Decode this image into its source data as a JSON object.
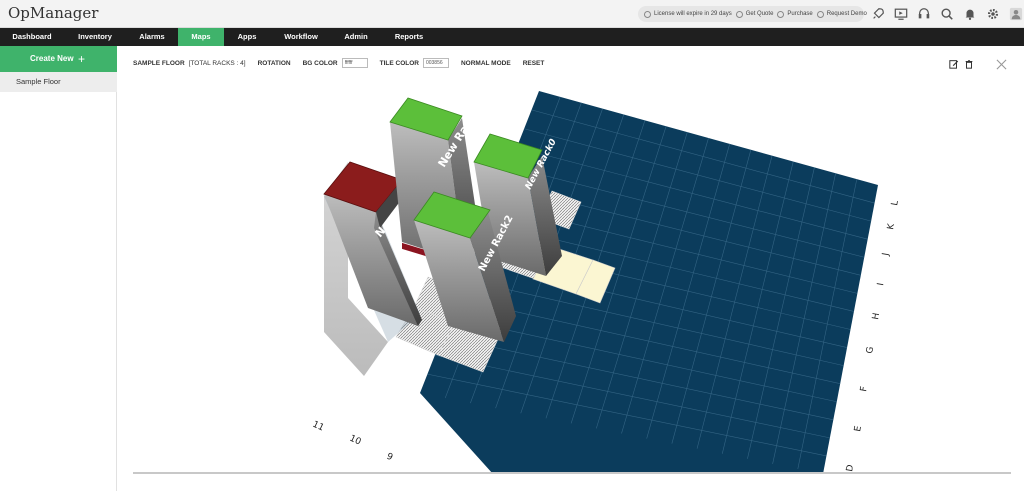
{
  "app": {
    "title": "OpManager"
  },
  "license_bar": {
    "items": [
      "License will expire in 29 days",
      "Get Quote",
      "Purchase",
      "Request Demo"
    ]
  },
  "header_icons": [
    "rocket-icon",
    "screen-icon",
    "headset-icon",
    "search-icon",
    "bell-icon",
    "gear-icon",
    "user-icon"
  ],
  "nav": {
    "items": [
      {
        "label": "Dashboard",
        "active": false
      },
      {
        "label": "Inventory",
        "active": false
      },
      {
        "label": "Alarms",
        "active": false
      },
      {
        "label": "Maps",
        "active": true
      },
      {
        "label": "Apps",
        "active": false
      },
      {
        "label": "Workflow",
        "active": false
      },
      {
        "label": "Admin",
        "active": false
      },
      {
        "label": "Reports",
        "active": false
      }
    ]
  },
  "sidebar": {
    "create_label": "Create New",
    "create_icon": "plus-icon",
    "items": [
      {
        "label": "Sample Floor"
      }
    ]
  },
  "toolbar": {
    "floor_name": "SAMPLE FLOOR",
    "rack_count": "[TOTAL RACKS : 4]",
    "rotation_label": "ROTATION",
    "bg_color_label": "BG COLOR",
    "bg_color_value": "ffffff",
    "tile_color_label": "TILE COLOR",
    "tile_color_value": "003856",
    "mode_label": "NORMAL MODE",
    "reset_label": "RESET"
  },
  "floor": {
    "tile_color": "#0b3c5c",
    "row_labels": [
      "D",
      "E",
      "F",
      "G",
      "H",
      "I",
      "J",
      "K",
      "L"
    ],
    "column_labels": [
      "11",
      "10",
      "9"
    ],
    "racks": [
      {
        "name": "New Rack",
        "top_color": "#8b1c1c"
      },
      {
        "name": "New Rack",
        "top_color": "#5cbf3a"
      },
      {
        "name": "New Rack0",
        "top_color": "#5cbf3a"
      },
      {
        "name": "New Rack2",
        "top_color": "#5cbf3a"
      }
    ]
  },
  "colors": {
    "accent": "#3fb36b",
    "nav_bg": "#1f1f1f",
    "highlight_tile": "#fbf6d2"
  }
}
